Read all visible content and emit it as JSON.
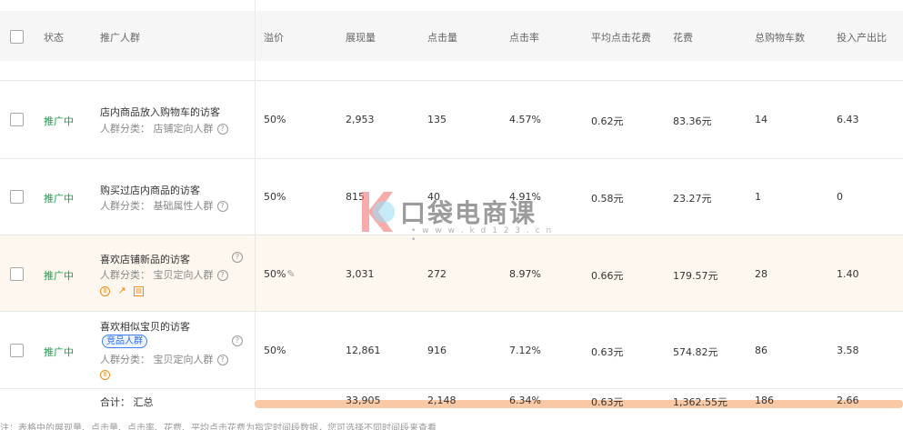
{
  "headers": {
    "status": "状态",
    "crowd": "推广人群",
    "premium": "溢价",
    "impressions": "展现量",
    "clicks": "点击量",
    "ctr": "点击率",
    "avg_cpc": "平均点击花费",
    "cost": "花费",
    "carts": "总购物车数",
    "roi": "投入产出比"
  },
  "rows": [
    {
      "status": "推广中",
      "name": "店内商品放入购物车的访客",
      "sub": "人群分类：  店铺定向人群",
      "premium": "50%",
      "impressions": "2,953",
      "clicks": "135",
      "ctr": "4.57%",
      "avg_cpc": "0.62元",
      "cost": "83.36元",
      "carts": "14",
      "roi": "6.43"
    },
    {
      "status": "推广中",
      "name": "购买过店内商品的访客",
      "sub": "人群分类：  基础属性人群",
      "premium": "50%",
      "impressions": "815",
      "clicks": "40",
      "ctr": "4.91%",
      "avg_cpc": "0.58元",
      "cost": "23.27元",
      "carts": "1",
      "roi": "0"
    },
    {
      "status": "推广中",
      "name": "喜欢店铺新品的访客",
      "sub": "人群分类：  宝贝定向人群",
      "premium": "50%",
      "impressions": "3,031",
      "clicks": "272",
      "ctr": "8.97%",
      "avg_cpc": "0.66元",
      "cost": "179.57元",
      "carts": "28",
      "roi": "1.40"
    },
    {
      "status": "推广中",
      "name": "喜欢相似宝贝的访客",
      "tag": "竞品人群",
      "sub": "人群分类：  宝贝定向人群",
      "premium": "50%",
      "impressions": "12,861",
      "clicks": "916",
      "ctr": "7.12%",
      "avg_cpc": "0.63元",
      "cost": "574.82元",
      "carts": "86",
      "roi": "3.58"
    }
  ],
  "total": {
    "label": "合计：  汇总",
    "impressions": "33,905",
    "clicks": "2,148",
    "ctr": "6.34%",
    "avg_cpc": "0.63元",
    "cost": "1,362.55元",
    "carts": "186",
    "roi": "2.66"
  },
  "footnote": "注：表格中的展现量、点击量、点击率、花费、平均点击花费为指定时间段数据，您可选择不同时间段来查看",
  "watermark": {
    "text": "口袋电商课",
    "url": "• w w w . k d 1 2 3 . c n •"
  },
  "icons": {
    "help": "?",
    "pause": "Ⅱ",
    "chart": "↗",
    "report": "▤",
    "edit": "✎"
  },
  "colors": {
    "status_green": "#1e9b4c",
    "highlight_row": "#fdf7ef",
    "tag_blue": "#3d7ef0",
    "orange": "#f08c1a"
  }
}
